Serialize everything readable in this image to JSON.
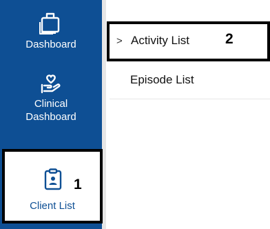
{
  "colors": {
    "sidebar_bg": "#0e4f94",
    "sidebar_text": "#ffffff",
    "highlight_border": "#000000"
  },
  "sidebar": {
    "items": [
      {
        "label": "Dashboard",
        "icon": "briefcase-icon"
      },
      {
        "label": "Clinical\nDashboard",
        "icon": "hand-heart-icon"
      },
      {
        "label": "Client List",
        "icon": "clipboard-user-icon",
        "annotation": "1",
        "selected": true
      }
    ]
  },
  "submenu": {
    "items": [
      {
        "label": "Activity List",
        "chevron": ">",
        "annotation": "2",
        "selected": true
      },
      {
        "label": "Episode List"
      }
    ]
  }
}
